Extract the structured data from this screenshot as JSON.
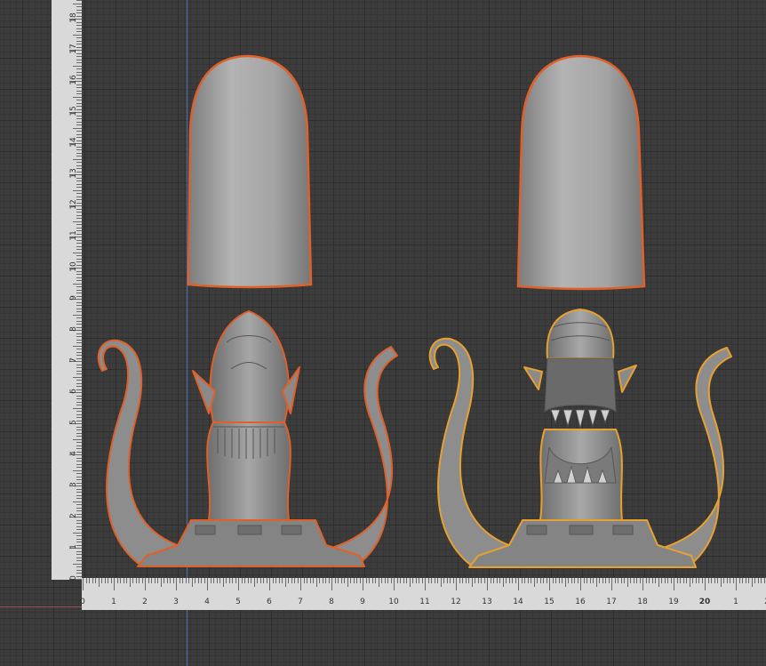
{
  "scene": {
    "background_color": "#3c3c3c",
    "grid_major_color": "#2e2e2e",
    "grid_minor_color": "#353535",
    "y_axis_color": "#4a6fb5",
    "x_axis_color": "#a05050"
  },
  "rulers": {
    "vertical": {
      "labels": [
        "0",
        "1",
        "2",
        "3",
        "4",
        "5",
        "6",
        "7",
        "8",
        "9",
        "10",
        "11",
        "12",
        "13",
        "14",
        "15",
        "16",
        "17",
        "18"
      ]
    },
    "horizontal": {
      "labels": [
        "0",
        "1",
        "2",
        "3",
        "4",
        "5",
        "6",
        "7",
        "8",
        "9",
        "10",
        "11",
        "12",
        "13",
        "14",
        "15",
        "16",
        "17",
        "18",
        "19",
        "20",
        "1",
        "2"
      ]
    }
  },
  "models": {
    "left_cap": {
      "selection_color": "#e0602a",
      "fill": "#9a9a9a"
    },
    "right_cap": {
      "selection_color": "#e0602a",
      "fill": "#9a9a9a"
    },
    "left_figure": {
      "selection_color": "#e0602a",
      "fill": "#8e8e8e"
    },
    "right_figure": {
      "selection_color": "#e8a030",
      "fill": "#8e8e8e"
    }
  }
}
